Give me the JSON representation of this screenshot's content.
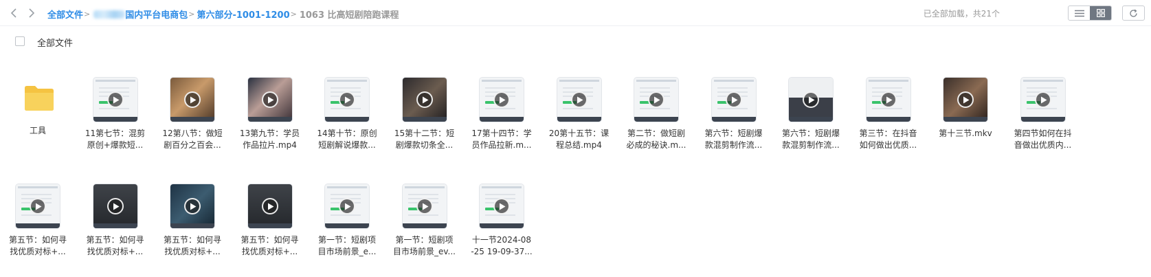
{
  "breadcrumb": {
    "root": "全部文件",
    "items": [
      {
        "label": "国内平台电商包",
        "redacted_prefix": true
      },
      {
        "label": "第六部分-1001-1200"
      },
      {
        "label": "1063 比高短剧陪跑课程",
        "current": true
      }
    ],
    "separator": ">"
  },
  "status_text": "已全部加载，共21个",
  "view_modes": [
    "list",
    "grid"
  ],
  "active_view": "grid",
  "select_all_label": "全部文件",
  "files": [
    {
      "type": "folder",
      "line1": "工具",
      "line2": ""
    },
    {
      "type": "video",
      "line1": "11第七节：混剪",
      "line2": "原创+爆款短...",
      "thumb": "light"
    },
    {
      "type": "video",
      "line1": "12第八节：做短",
      "line2": "剧百分之百会...",
      "thumb": "photo-warm"
    },
    {
      "type": "video",
      "line1": "13第九节：学员",
      "line2": "作品拉片.mp4",
      "thumb": "photo-face"
    },
    {
      "type": "video",
      "line1": "14第十节：原创",
      "line2": "短剧解说爆款...",
      "thumb": "light"
    },
    {
      "type": "video",
      "line1": "15第十二节：短",
      "line2": "剧爆款切条全...",
      "thumb": "grid-dark"
    },
    {
      "type": "video",
      "line1": "17第十四节：学",
      "line2": "员作品拉新.m...",
      "thumb": "light"
    },
    {
      "type": "video",
      "line1": "20第十五节：课",
      "line2": "程总结.mp4",
      "thumb": "light"
    },
    {
      "type": "video",
      "line1": "第二节：做短剧",
      "line2": "必成的秘诀.m...",
      "thumb": "light"
    },
    {
      "type": "video",
      "line1": "第六节：短剧爆",
      "line2": "款混剪制作流...",
      "thumb": "light"
    },
    {
      "type": "video",
      "line1": "第六节：短剧爆",
      "line2": "款混剪制作流...",
      "thumb": "mixed"
    },
    {
      "type": "video",
      "line1": "第三节：在抖音",
      "line2": "如何做出优质...",
      "thumb": "light"
    },
    {
      "type": "video",
      "line1": "第十三节.mkv",
      "line2": "",
      "thumb": "photo-dark"
    },
    {
      "type": "video",
      "line1": "第四节如何在抖",
      "line2": "音做出优质内...",
      "thumb": "light"
    },
    {
      "type": "video",
      "line1": "第五节：如何寻",
      "line2": "找优质对标+...",
      "thumb": "light"
    },
    {
      "type": "video",
      "line1": "第五节：如何寻",
      "line2": "找优质对标+...",
      "thumb": "editor-dark"
    },
    {
      "type": "video",
      "line1": "第五节：如何寻",
      "line2": "找优质对标+...",
      "thumb": "editor-blue"
    },
    {
      "type": "video",
      "line1": "第五节：如何寻",
      "line2": "找优质对标+...",
      "thumb": "editor-dark"
    },
    {
      "type": "video",
      "line1": "第一节：短剧项",
      "line2": "目市场前景_e...",
      "thumb": "light"
    },
    {
      "type": "video",
      "line1": "第一节：短剧项",
      "line2": "目市场前景_ev...",
      "thumb": "light"
    },
    {
      "type": "video",
      "line1": "十一节2024-08",
      "line2": "-25 19-09-37...",
      "thumb": "light-dark"
    }
  ],
  "colors": {
    "link": "#2e8ce6",
    "muted": "#999999",
    "folder": "#f5c342",
    "toggle_active": "#6f7782"
  },
  "icons": [
    "back-arrow-icon",
    "forward-arrow-icon",
    "list-view-icon",
    "grid-view-icon",
    "refresh-icon",
    "folder-icon",
    "play-icon"
  ]
}
